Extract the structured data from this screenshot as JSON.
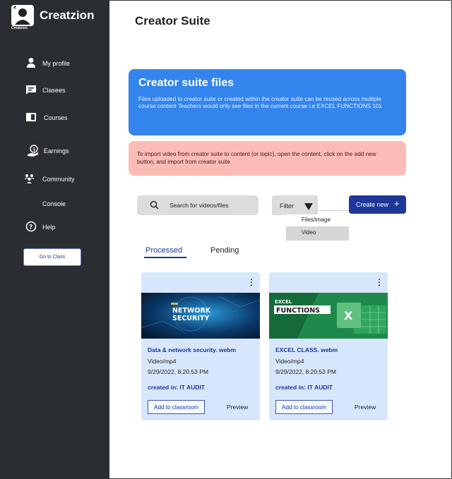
{
  "app": {
    "name": "Creatzion",
    "logo_caption": "Creatzion"
  },
  "sidebar": {
    "items": [
      {
        "label": "My profile",
        "icon": "person-icon"
      },
      {
        "label": "Clasees",
        "icon": "message-icon"
      },
      {
        "label": "Courses",
        "icon": "book-icon"
      },
      {
        "label": "Earnings",
        "icon": "earnings-icon"
      },
      {
        "label": "Community",
        "icon": "community-icon"
      },
      {
        "label": "Console",
        "icon": ""
      },
      {
        "label": "Help",
        "icon": "help-icon"
      }
    ],
    "go_class_label": "Go to Class"
  },
  "page": {
    "title": "Creator Suite"
  },
  "info_blue": {
    "title": "Creator suite files",
    "text": "Files uploaded to creator suite or created within the creator suite can be reused across multiple course content Teachers would only see files in the current course i.e EXCEL FUNCTIONS 101"
  },
  "info_pink": {
    "text": "To import video from creator suite to content (or topic), open the content, click on the add new button, and import from creator suite"
  },
  "toolbar": {
    "search_placeholder": "Search for videos/files",
    "filter_label": "Filter",
    "filter_options": [
      "Files/image",
      "Video"
    ],
    "create_label": "Create new",
    "create_icon": "plus-icon"
  },
  "tabs": [
    {
      "label": "Processed",
      "active": true
    },
    {
      "label": "Pending",
      "active": false
    }
  ],
  "cards": [
    {
      "name": "Data & network security. webm",
      "type": "Video/mp4",
      "date": "9/29/2022, 8:20:53 PM",
      "created_in": "created in: IT AUDIT",
      "thumb_text": [
        "NETWORK",
        "SECURITY"
      ],
      "add_label": "Add to classroom",
      "preview_label": "Preview"
    },
    {
      "name": "EXCEL CLASS. webm",
      "type": "Video/mp4",
      "date": "9/29/2022, 8:20:53 PM",
      "created_in": "created in: IT AUDIT",
      "thumb_text": [
        "EXCEL",
        "FUNCTIONS",
        "X"
      ],
      "add_label": "Add to classroom",
      "preview_label": "Preview"
    }
  ],
  "colors": {
    "sidebar": "#2a2d31",
    "accent": "#1e3799",
    "info_blue": "#3385ed",
    "info_pink": "#fcbcb6",
    "card_bg": "#d8e6fb",
    "excel_green": "#1e8a4a"
  }
}
